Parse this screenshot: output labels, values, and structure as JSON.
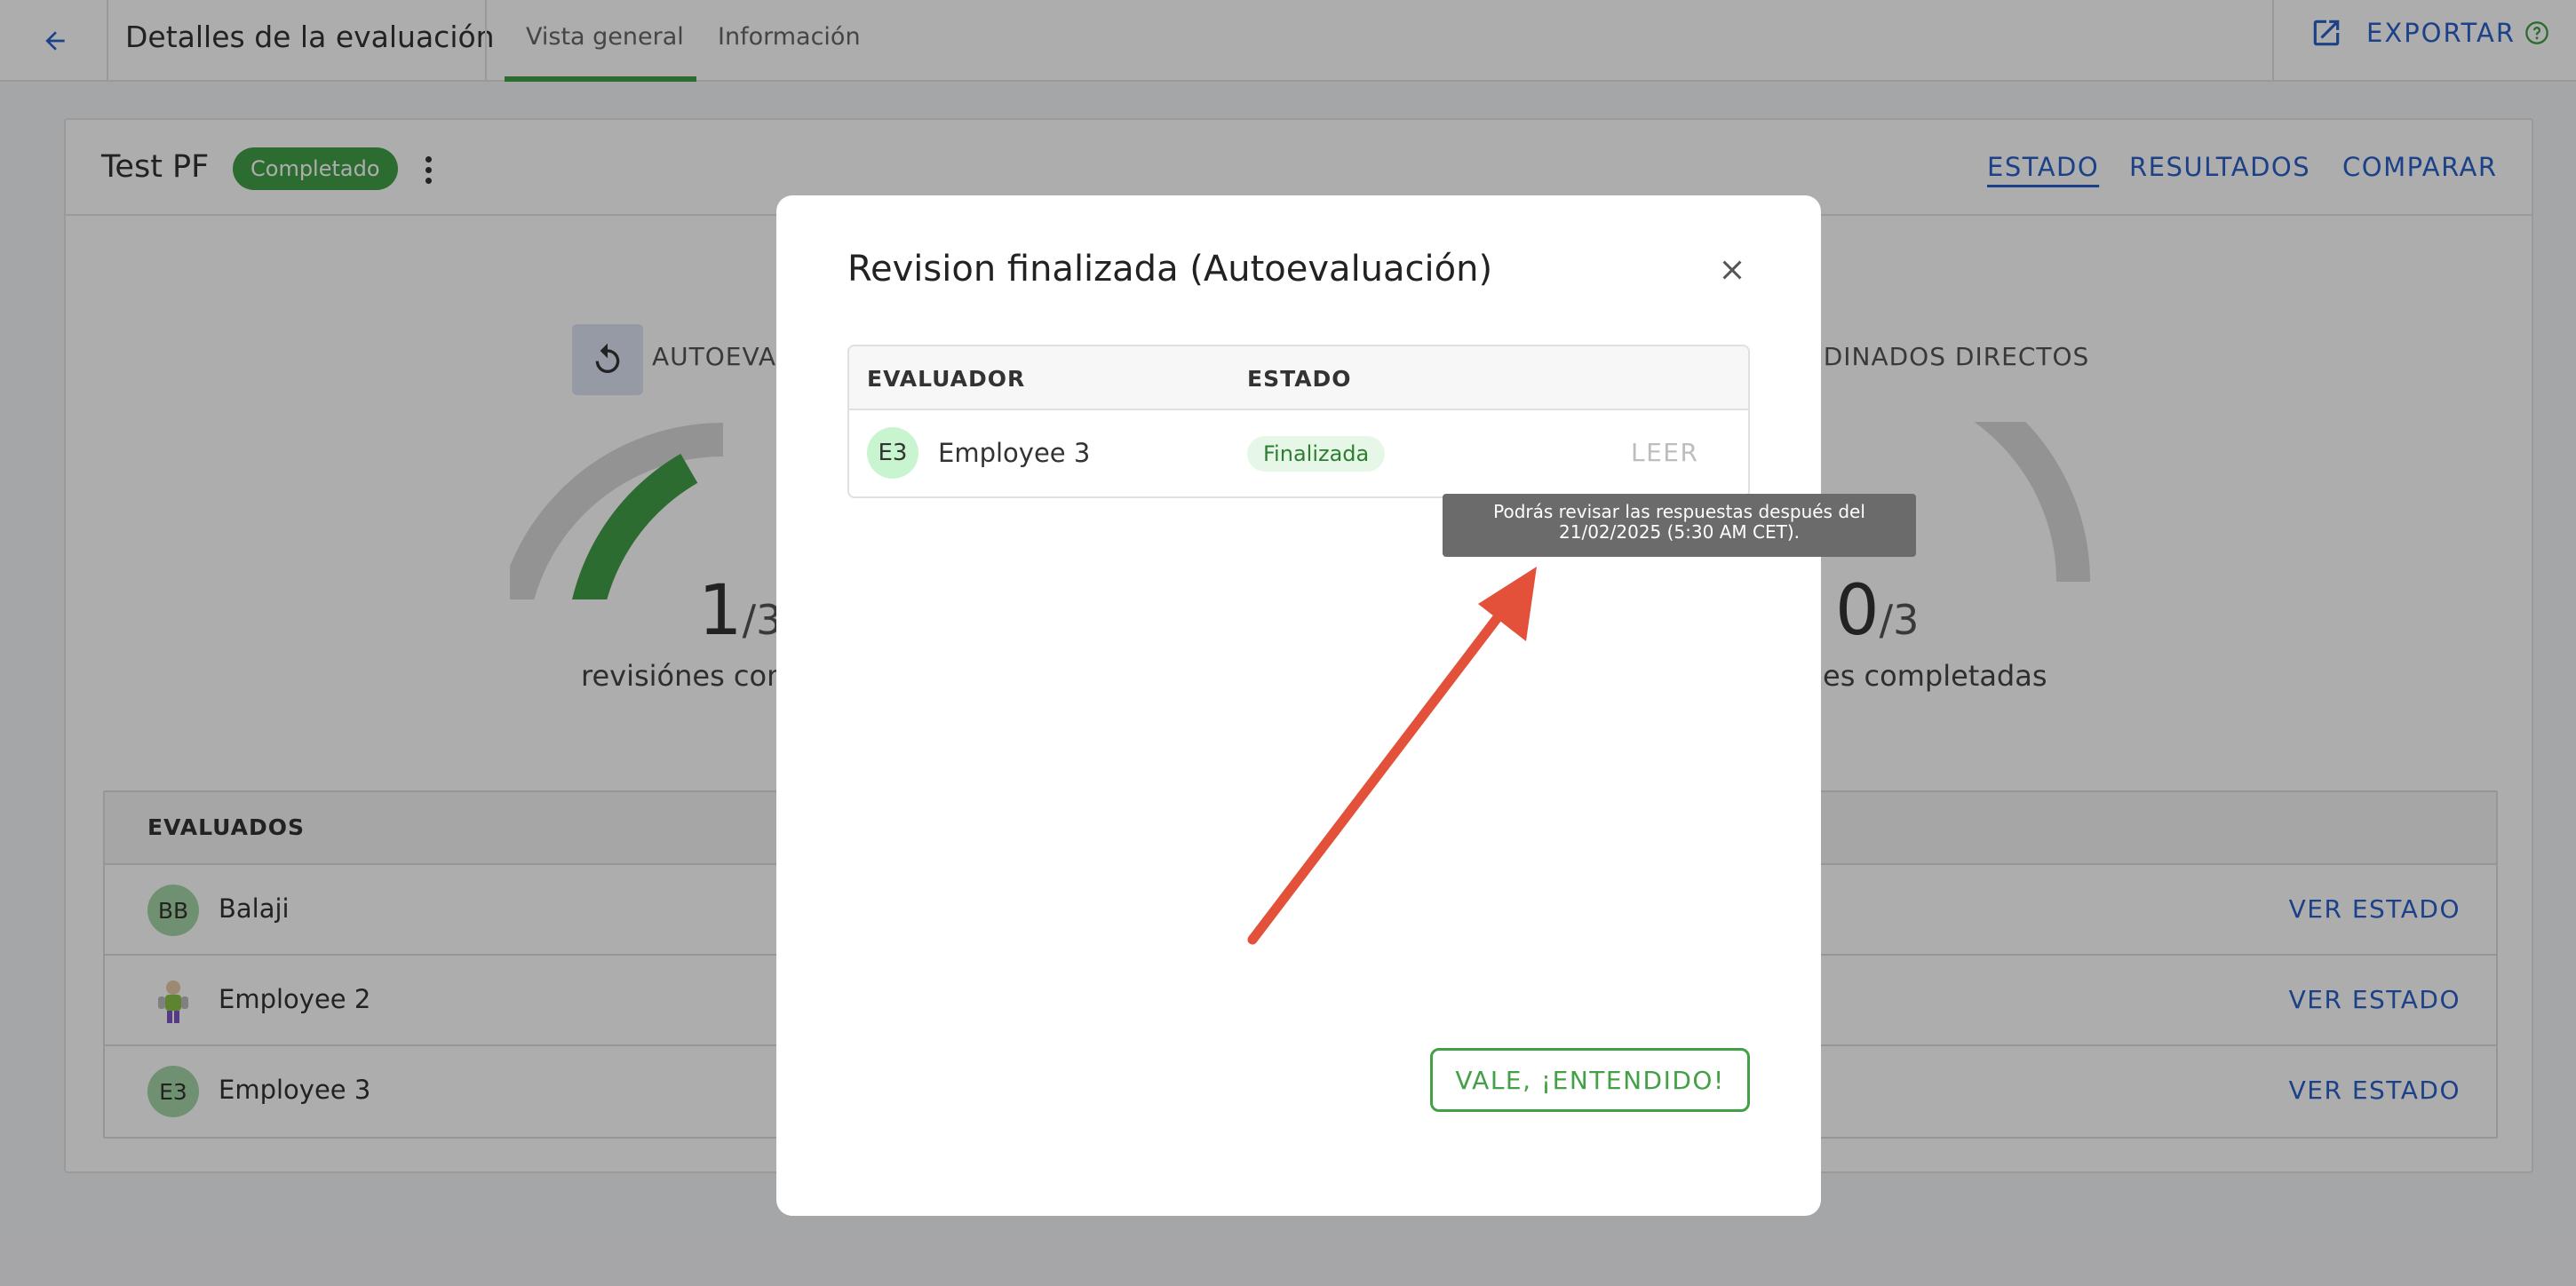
{
  "topbar": {
    "title": "Detalles de la evaluación",
    "tabs": [
      "Vista general",
      "Información"
    ],
    "export_label": "EXPORTAR"
  },
  "card": {
    "evaluation_name": "Test PF",
    "status_badge": "Completado",
    "nav": [
      "ESTADO",
      "RESULTADOS",
      "COMPARAR"
    ],
    "sections": [
      {
        "label": "AUTOEVA",
        "completed": 1,
        "total": "3",
        "caption": "revisiónes com",
        "progress": 0.333
      },
      {
        "label": "EDINADOS DIRECTOS",
        "completed": 0,
        "total": "3",
        "caption": "es completadas",
        "progress": 0
      }
    ],
    "people_header": "EVALUADOS",
    "people": [
      {
        "initials": "BB",
        "name": "Balaji",
        "action": "VER ESTADO",
        "avatar": "initials"
      },
      {
        "initials": "",
        "name": "Employee 2",
        "action": "VER ESTADO",
        "avatar": "toy-figure-image"
      },
      {
        "initials": "E3",
        "name": "Employee 3",
        "action": "VER ESTADO",
        "avatar": "initials"
      }
    ]
  },
  "modal": {
    "title": "Revision finalizada (Autoevaluación)",
    "columns": [
      "EVALUADOR",
      "ESTADO"
    ],
    "row": {
      "initials": "E3",
      "name": "Employee 3",
      "status": "Finalizada",
      "action": "LEER"
    },
    "tooltip_line1": "Podrás revisar las respuestas después del",
    "tooltip_line2": "21/02/2025 (5:30 AM CET).",
    "confirm_label": "VALE, ¡ENTENDIDO!"
  },
  "colors": {
    "accent_blue": "#2a61c9",
    "success_green": "#43a047",
    "annotation_arrow": "#e4513a",
    "gauge_track": "#d9d9d9"
  }
}
